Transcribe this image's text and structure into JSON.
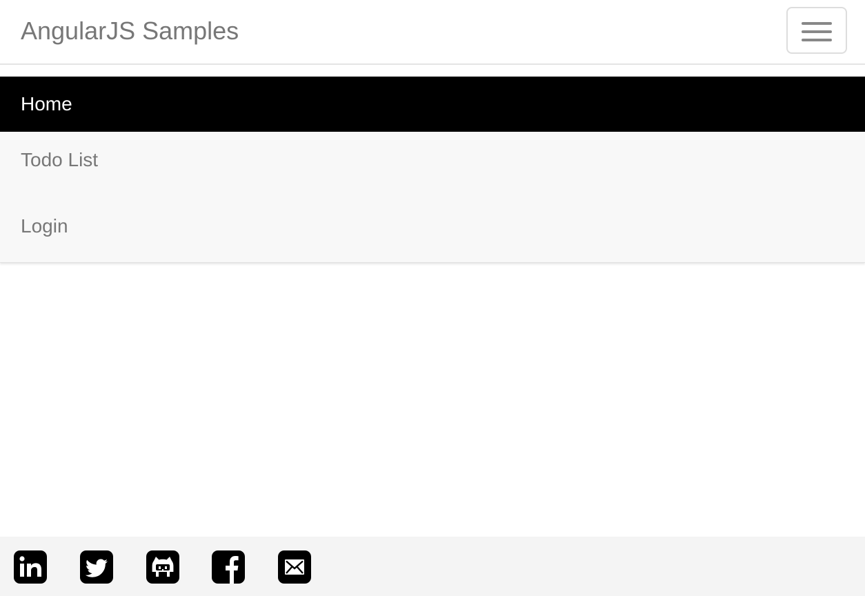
{
  "navbar": {
    "brand": "AngularJS Samples",
    "toggle_icon": "hamburger-menu-icon"
  },
  "menu": {
    "items": [
      {
        "label": "Home",
        "active": true
      },
      {
        "label": "Todo List",
        "active": false
      },
      {
        "label": "Login",
        "active": false
      }
    ]
  },
  "footer": {
    "social_icons": [
      "linkedin-icon",
      "twitter-icon",
      "github-icon",
      "facebook-icon",
      "email-icon"
    ]
  },
  "colors": {
    "active_bg": "#000000",
    "active_text": "#ffffff",
    "menu_text": "#777777",
    "menu_bg": "#f8f8f8",
    "footer_bg": "#f4f4f4"
  }
}
